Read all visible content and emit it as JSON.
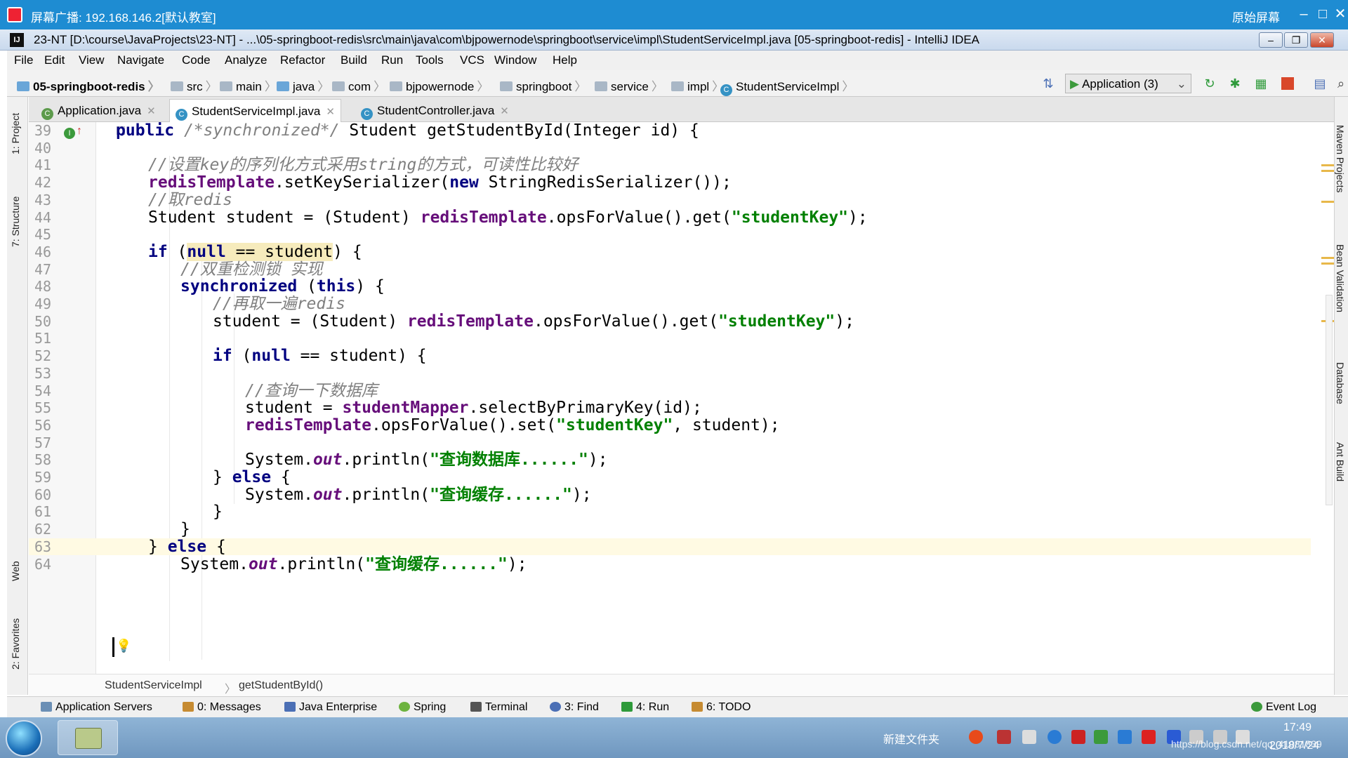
{
  "broadcast": {
    "title": "屏幕广播: 192.168.146.2[默认教室]",
    "original_label": "原始屏幕",
    "min": "–",
    "max": "□",
    "close": "✕"
  },
  "window": {
    "title": "23-NT [D:\\course\\JavaProjects\\23-NT] - ...\\05-springboot-redis\\src\\main\\java\\com\\bjpowernode\\springboot\\service\\impl\\StudentServiceImpl.java [05-springboot-redis] - IntelliJ IDEA",
    "icon_text": "IJ"
  },
  "menu": [
    "File",
    "Edit",
    "View",
    "Navigate",
    "Code",
    "Analyze",
    "Refactor",
    "Build",
    "Run",
    "Tools",
    "VCS",
    "Window",
    "Help"
  ],
  "nav": {
    "crumbs": [
      "05-springboot-redis",
      "src",
      "main",
      "java",
      "com",
      "bjpowernode",
      "springboot",
      "service",
      "impl",
      "StudentServiceImpl"
    ],
    "run_config": "Application (3)"
  },
  "left_tools": [
    "1: Project",
    "7: Structure",
    "Web",
    "2: Favorites"
  ],
  "right_tools": [
    "Maven Projects",
    "Bean Validation",
    "Database",
    "Ant Build"
  ],
  "tabs": [
    {
      "label": "Application.java",
      "active": false
    },
    {
      "label": "StudentServiceImpl.java",
      "active": true
    },
    {
      "label": "StudentController.java",
      "active": false
    }
  ],
  "code": {
    "line_numbers": [
      "39",
      "40",
      "41",
      "42",
      "43",
      "44",
      "45",
      "46",
      "47",
      "48",
      "49",
      "50",
      "51",
      "52",
      "53",
      "54",
      "55",
      "56",
      "57",
      "58",
      "59",
      "60",
      "61",
      "62",
      "63",
      "64"
    ],
    "l39": [
      "public",
      " /*synchronized*/",
      " Student getStudentById(Integer id) {"
    ],
    "l41": "//设置key的序列化方式采用string的方式，可读性比较好",
    "l42": [
      "redisTemplate",
      ".setKeySerializer(",
      "new",
      " StringRedisSerializer());"
    ],
    "l43": "//取redis",
    "l44": [
      "Student student = (Student) ",
      "redisTemplate",
      ".opsForValue().get(",
      "\"studentKey\"",
      ");"
    ],
    "l46": [
      "if",
      " (",
      "null",
      " == student",
      ") {"
    ],
    "l47": "//双重检测锁 实现",
    "l48": [
      "synchronized",
      " (",
      "this",
      ") {"
    ],
    "l49": "//再取一遍redis",
    "l50": [
      "student = (Student) ",
      "redisTemplate",
      ".opsForValue().get(",
      "\"studentKey\"",
      ");"
    ],
    "l52": [
      "if",
      " (",
      "null",
      " == student) {"
    ],
    "l54": "//查询一下数据库",
    "l55": [
      "student = ",
      "studentMapper",
      ".selectByPrimaryKey(id);"
    ],
    "l56": [
      "redisTemplate",
      ".opsForValue().set(",
      "\"studentKey\"",
      ", student);"
    ],
    "l58": [
      "System.",
      "out",
      ".println(",
      "\"查询数据库......\"",
      ");"
    ],
    "l59": [
      "} ",
      "else",
      " {"
    ],
    "l60": [
      "System.",
      "out",
      ".println(",
      "\"查询缓存......\"",
      ");"
    ],
    "l61": "}",
    "l62": "}",
    "l63": [
      "} ",
      "else",
      " {"
    ],
    "l64": [
      "System.",
      "out",
      ".println(",
      "\"查询缓存......\"",
      ");"
    ]
  },
  "editor_breadcrumb": [
    "StudentServiceImpl",
    "getStudentById()"
  ],
  "bottom_tools": [
    "Application Servers",
    "0: Messages",
    "Java Enterprise",
    "Spring",
    "Terminal",
    "3: Find",
    "4: Run",
    "6: TODO",
    "Event Log"
  ],
  "taskbar": {
    "tray_text": "新建文件夹",
    "time": "17:49",
    "date": "2018/7/24",
    "watermark": "https://blog.csdn.net/qq_41081839"
  },
  "colors": {
    "broadcast_bar": "#1e8cd2",
    "keyword": "#000080",
    "string": "#008000",
    "field": "#660e7a",
    "comment": "#808080",
    "current_line": "#fffae3"
  }
}
